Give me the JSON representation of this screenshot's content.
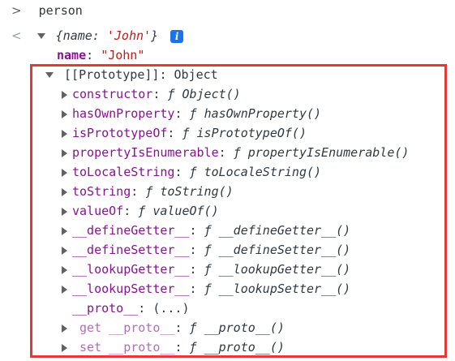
{
  "console": {
    "input_chevron": ">",
    "input_text": "person",
    "result_chevron": "<",
    "object_summary": {
      "open": "{",
      "key": "name",
      "colon": ": ",
      "value": "'John'",
      "close": "}",
      "info_badge": "i"
    },
    "name_prop": {
      "key": "name",
      "colon": ": ",
      "value": "\"John\""
    },
    "prototype": {
      "label": "[[Prototype]]",
      "colon": ": ",
      "type": "Object"
    },
    "members": [
      {
        "key": "constructor",
        "sep": ": ",
        "f": "ƒ",
        "value": "Object()"
      },
      {
        "key": "hasOwnProperty",
        "sep": ": ",
        "f": "ƒ",
        "value": "hasOwnProperty()"
      },
      {
        "key": "isPrototypeOf",
        "sep": ": ",
        "f": "ƒ",
        "value": "isPrototypeOf()"
      },
      {
        "key": "propertyIsEnumerable",
        "sep": ": ",
        "f": "ƒ",
        "value": "propertyIsEnumerable()"
      },
      {
        "key": "toLocaleString",
        "sep": ": ",
        "f": "ƒ",
        "value": "toLocaleString()"
      },
      {
        "key": "toString",
        "sep": ": ",
        "f": "ƒ",
        "value": "toString()"
      },
      {
        "key": "valueOf",
        "sep": ": ",
        "f": "ƒ",
        "value": "valueOf()"
      },
      {
        "key": "__defineGetter__",
        "sep": ": ",
        "f": "ƒ",
        "value": "__defineGetter__()"
      },
      {
        "key": "__defineSetter__",
        "sep": ": ",
        "f": "ƒ",
        "value": "__defineSetter__()"
      },
      {
        "key": "__lookupGetter__",
        "sep": ": ",
        "f": "ƒ",
        "value": "__lookupGetter__()"
      },
      {
        "key": "__lookupSetter__",
        "sep": ": ",
        "f": "ƒ",
        "value": "__lookupSetter__()"
      }
    ],
    "proto_prop": {
      "key": "__proto__",
      "sep": ": ",
      "value": "(...)"
    },
    "get_proto": {
      "prefix": "get ",
      "key": "__proto__",
      "sep": ": ",
      "f": "ƒ",
      "value": "__proto__()"
    },
    "set_proto": {
      "prefix": "set ",
      "key": "__proto__",
      "sep": ": ",
      "f": "ƒ",
      "value": "__proto__()"
    }
  },
  "colors": {
    "key": "#881391",
    "string": "#c41a16",
    "highlight": "#e53935",
    "info": "#1a73e8"
  }
}
